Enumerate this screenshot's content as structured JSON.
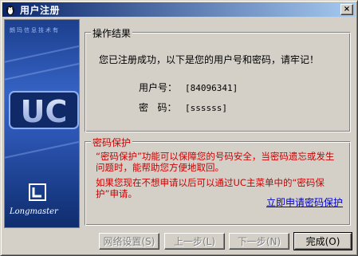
{
  "window": {
    "title": "用户注册",
    "close_glyph": "×"
  },
  "banner": {
    "header_text": "朗玛信息技术有",
    "logo_text": "UC",
    "brand_text": "Longmaster"
  },
  "result": {
    "legend": "操作结果",
    "message": "您已注册成功，以下是您的用户号和密码，请牢记！",
    "user_label": "用户号：",
    "user_value": "[84096341]",
    "password_label": "密   码：",
    "password_value": "[ssssss]"
  },
  "protection": {
    "legend": "密码保护",
    "paragraph1": "“密码保护”功能可以保障您的号码安全，当密码遗忘或发生问题时，能帮助您方便地取回。",
    "paragraph2": "如果您现在不想申请以后可以通过UC主菜单中的“密码保护”申请。",
    "link_label": "立即申请密码保护"
  },
  "buttons": {
    "network_settings": "网络设置(S)",
    "previous": "上一步(L)",
    "next": "下一步(N)",
    "finish": "完成(O)"
  },
  "colors": {
    "titlebar_start": "#0a246a",
    "titlebar_end": "#a6caf0",
    "warning_text": "#cc0000",
    "link": "#0000cc",
    "dialog_bg": "#d4d0c8"
  }
}
